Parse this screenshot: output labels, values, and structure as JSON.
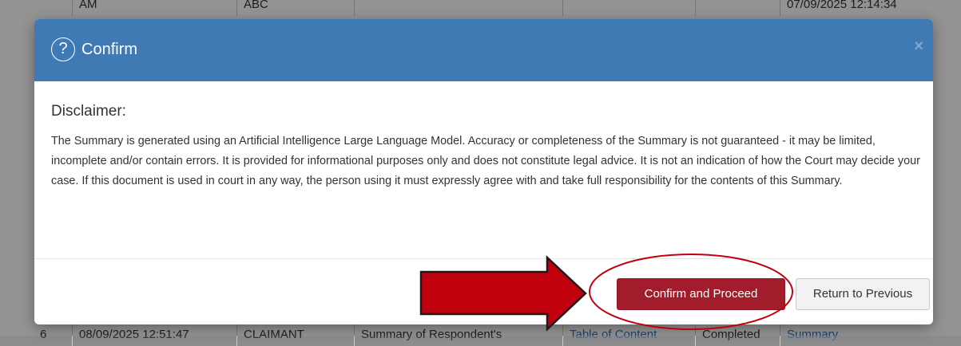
{
  "background_table": {
    "top_row": [
      "AM",
      "ABC",
      "",
      "",
      "",
      "07/09/2025 12:14:34"
    ],
    "bottom_row": [
      "6",
      "08/09/2025 12:51:47",
      "CLAIMANT",
      "Summary of Respondent's",
      "Table of Content",
      "Completed",
      "Summary"
    ]
  },
  "modal": {
    "title": "Confirm",
    "help_icon": "?",
    "close_icon": "×",
    "heading": "Disclaimer:",
    "text": "The Summary is generated using an Artificial Intelligence Large Language Model. Accuracy or completeness of the Summary is not guaranteed - it may be limited, incomplete and/or contain errors. It is provided for informational purposes only and does not constitute legal advice. It is not an indication of how the Court may decide your case. If this document is used in court in any way, the person using it must expressly agree with and take full responsibility for the contents of this Summary.",
    "confirm_label": "Confirm and Proceed",
    "return_label": "Return to Previous"
  },
  "colors": {
    "header": "#3f7ab5",
    "confirm_button": "#a31c2b",
    "annotation": "#c0000c"
  },
  "icons": {
    "help": "question-circle-icon",
    "close": "close-icon",
    "annotation_arrow": "arrow-right-icon"
  }
}
